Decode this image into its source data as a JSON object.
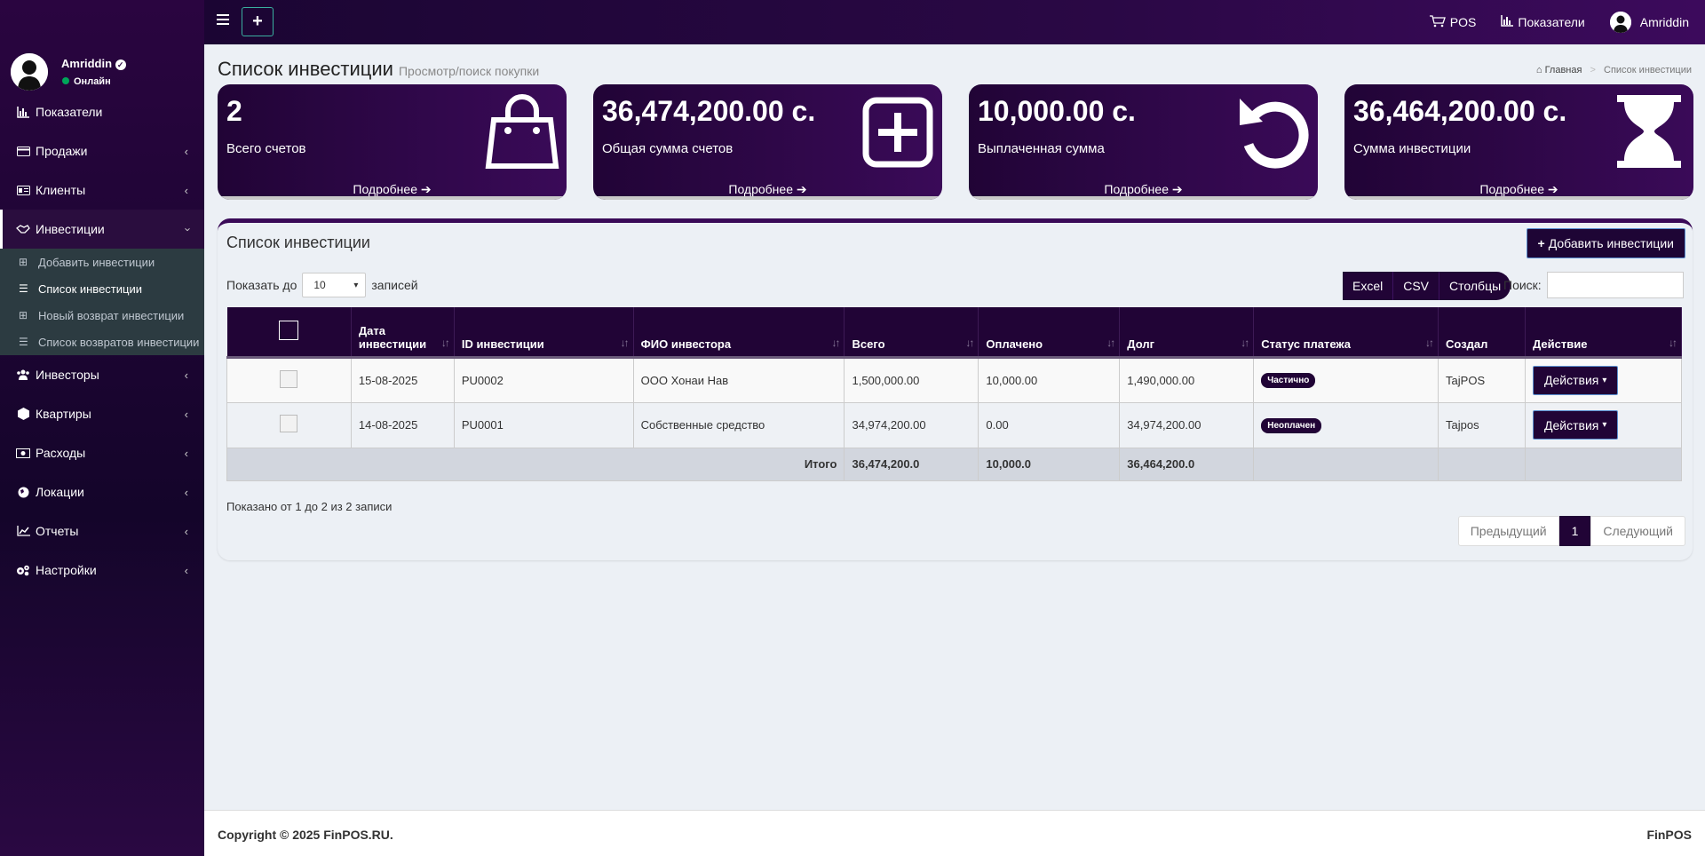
{
  "sidebar": {
    "username": "Amriddin",
    "status": "Онлайн",
    "menu": [
      {
        "label": "Показатели",
        "icon": "bar-chart-icon"
      },
      {
        "label": "Продажи",
        "icon": "credit-card-icon"
      },
      {
        "label": "Клиенты",
        "icon": "id-card-icon"
      },
      {
        "label": "Инвестиции",
        "icon": "handshake-icon"
      },
      {
        "label": "Инвесторы",
        "icon": "users-icon"
      },
      {
        "label": "Квартиры",
        "icon": "cube-icon"
      },
      {
        "label": "Расходы",
        "icon": "money-icon"
      },
      {
        "label": "Локации",
        "icon": "globe-icon"
      },
      {
        "label": "Отчеты",
        "icon": "line-chart-icon"
      },
      {
        "label": "Настройки",
        "icon": "cogs-icon"
      }
    ],
    "submenu": [
      {
        "label": "Добавить инвестиции"
      },
      {
        "label": "Список инвестиции"
      },
      {
        "label": "Новый возврат инвестиции"
      },
      {
        "label": "Список возвратов инвестиции"
      }
    ]
  },
  "topbar": {
    "plus": "+",
    "pos": "POS",
    "dashboard": "Показатели",
    "user": "Amriddin"
  },
  "page": {
    "title": "Список инвестиции",
    "subtitle": "Просмотр/поиск покупки",
    "breadcrumb_home": "Главная",
    "breadcrumb_current": "Список инвестиции"
  },
  "stats": [
    {
      "value": "2",
      "label": "Всего счетов",
      "more": "Подробнее",
      "icon": "shopping-bag-icon"
    },
    {
      "value": "36,474,200.00 с.",
      "label": "Общая сумма счетов",
      "more": "Подробнее",
      "icon": "plus-square-icon"
    },
    {
      "value": "10,000.00 с.",
      "label": "Выплаченная сумма",
      "more": "Подробнее",
      "icon": "undo-icon"
    },
    {
      "value": "36,464,200.00 с.",
      "label": "Сумма инвестиции",
      "more": "Подробнее",
      "icon": "hourglass-icon"
    }
  ],
  "list": {
    "title": "Список инвестиции",
    "add_button": "Добавить инвестиции",
    "show_prefix": "Показать до",
    "page_size": "10",
    "show_suffix": "записей",
    "export": [
      "Excel",
      "CSV",
      "Столбцы"
    ],
    "search_label": "Поиск:",
    "columns": [
      "Дата инвестиции",
      "ID инвестиции",
      "ФИО инвестора",
      "Всего",
      "Оплачено",
      "Долг",
      "Статус платежа",
      "Создал",
      "Действие"
    ],
    "rows": [
      {
        "date": "15-08-2025",
        "id": "PU0002",
        "investor": "ООО Хонаи Нав",
        "total": "1,500,000.00",
        "paid": "10,000.00",
        "debt": "1,490,000.00",
        "status": "Частично",
        "creator": "TajPOS",
        "action": "Действия"
      },
      {
        "date": "14-08-2025",
        "id": "PU0001",
        "investor": "Собственные средство",
        "total": "34,974,200.00",
        "paid": "0.00",
        "debt": "34,974,200.00",
        "status": "Неоплачен",
        "creator": "Tajpos",
        "action": "Действия"
      }
    ],
    "footer": {
      "label": "Итого",
      "total": "36,474,200.0",
      "paid": "10,000.0",
      "debt": "36,464,200.0"
    },
    "info": "Показано от 1 до 2 из 2 записи",
    "pager": {
      "prev": "Предыдущий",
      "current": "1",
      "next": "Следующий"
    }
  },
  "footer": {
    "copyright": "Copyright © 2025 FinPOS.RU.",
    "brand": "FinPOS"
  }
}
